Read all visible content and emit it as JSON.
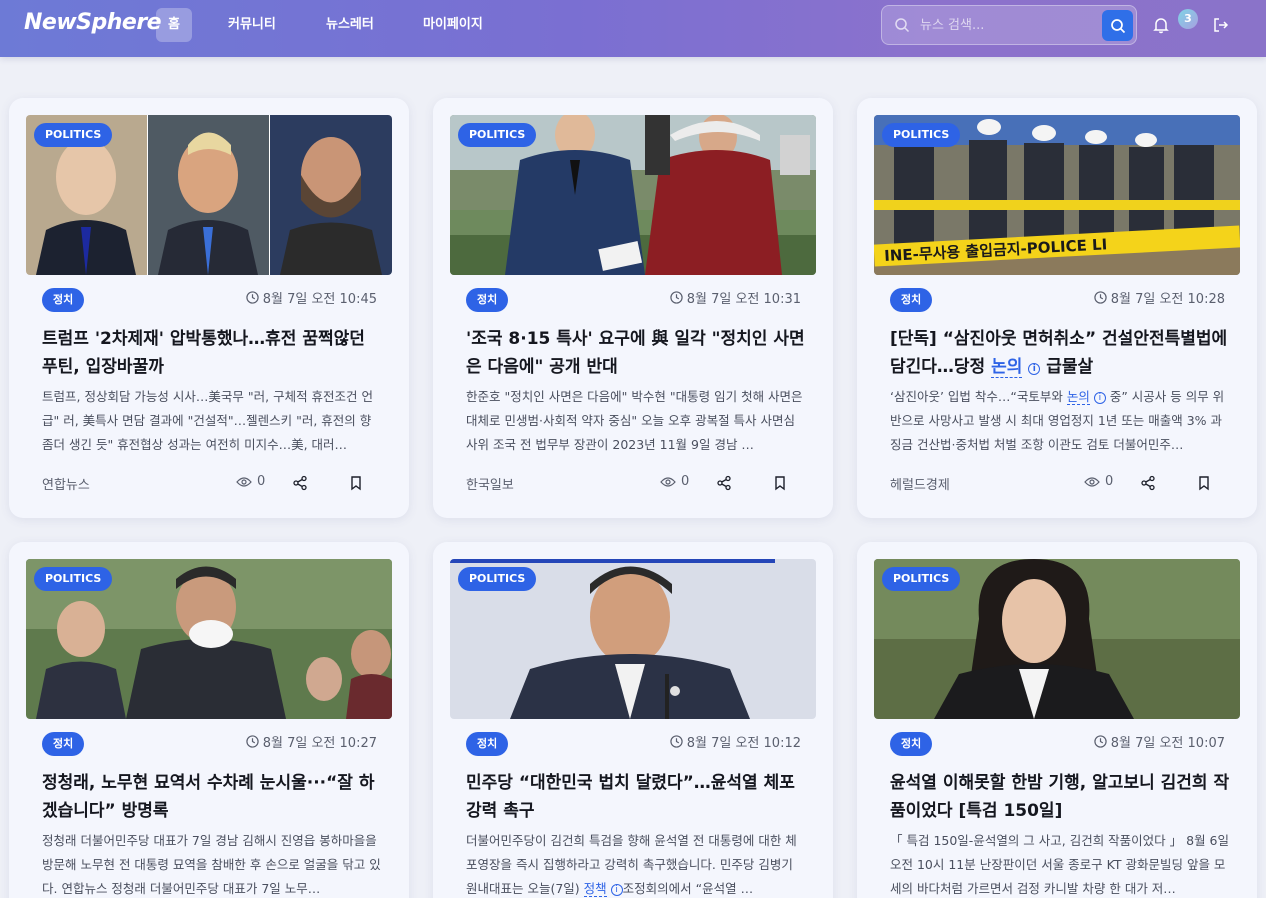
{
  "header": {
    "logo": "NewSphere",
    "nav": [
      "홈",
      "커뮤니티",
      "뉴스레터",
      "마이페이지"
    ],
    "search_placeholder": "뉴스 검색...",
    "notification_count": "3"
  },
  "colors": {
    "accent": "#2e63e6",
    "header_start": "#6d7ad6",
    "header_end": "#8a73c9"
  },
  "cards": [
    {
      "category": "POLITICS",
      "tag": "정치",
      "time": "8월 7일 오전 10:45",
      "title": "트럼프 '2차제재' 압박통했나…휴전 꿈쩍않던 푸틴, 입장바꿀까",
      "summary": "트럼프, 정상회담 가능성 시사…美국무 \"러, 구체적 휴전조건 언급\" 러, 美특사 면담 결과에 \"건설적\"…젤렌스키 \"러, 휴전의 향 좀더 생긴 듯\" 휴전협상 성과는 여전히 미지수…美, 대러…",
      "source": "연합뉴스",
      "views": "0"
    },
    {
      "category": "POLITICS",
      "tag": "정치",
      "time": "8월 7일 오전 10:31",
      "title": "'조국 8·15 특사' 요구에 與 일각 \"정치인 사면은 다음에\" 공개 반대",
      "summary": "한준호 \"정치인 사면은 다음에\" 박수현 \"대통령 임기 첫해 사면은 대체로 민생범·사회적 약자 중심\" 오늘 오후 광복절 특사 사면심사위 조국 전 법무부 장관이 2023년 11월 9일 경남 …",
      "source": "한국일보",
      "views": "0"
    },
    {
      "category": "POLITICS",
      "tag": "정치",
      "time": "8월 7일 오전 10:28",
      "title_pre": "[단독] “삼진아웃 면허취소” 건설안전특별법에 담긴다…당정 ",
      "title_hl": "논의",
      "title_post": " 급물살",
      "summary_pre": "‘삼진아웃’ 입법 착수…“국토부와 ",
      "summary_hl": "논의",
      "summary_post": " 중” 시공사 등 의무 위반으로 사망사고 발생 시 최대 영업정지 1년 또는 매출액 3% 과징금 건산법·중처법 처벌 조항 이관도 검토 더불어민주…",
      "info_glyph": "i",
      "source": "헤럴드경제",
      "views": "0"
    },
    {
      "category": "POLITICS",
      "tag": "정치",
      "time": "8월 7일 오전 10:27",
      "title": "정청래, 노무현 묘역서 수차례 눈시울···“잘 하겠습니다” 방명록",
      "summary": "정청래 더불어민주당 대표가 7일 경남 김해시 진영읍 봉하마을을 방문해 노무현 전 대통령 묘역을 참배한 후 손으로 얼굴을 닦고 있다. 연합뉴스 정청래 더불어민주당 대표가 7일 노무…"
    },
    {
      "category": "POLITICS",
      "tag": "정치",
      "time": "8월 7일 오전 10:12",
      "title": "민주당 “대한민국 법치 달렸다”…윤석열 체포 강력 촉구",
      "summary_pre": "더불어민주당이 김건희 특검을 향해 윤석열 전 대통령에 대한 체포영장을 즉시 집행하라고 강력히 촉구했습니다. 민주당 김병기 원내대표는 오늘(7일) ",
      "summary_hl": "정책",
      "summary_post": "조정회의에서 “윤석열 …",
      "info_glyph": "i"
    },
    {
      "category": "POLITICS",
      "tag": "정치",
      "time": "8월 7일 오전 10:07",
      "title": "윤석열 이해못할 한밤 기행, 알고보니 김건희 작품이었다 [특검 150일]",
      "summary": "「 특검 150일-윤석열의 그 사고, 김건희 작품이었다 」 8월 6일 오전 10시 11분 난장판이던 서울 종로구 KT 광화문빌딩 앞을 모세의 바다처럼 가르면서 검정 카니발 차량 한 대가 저…"
    }
  ]
}
